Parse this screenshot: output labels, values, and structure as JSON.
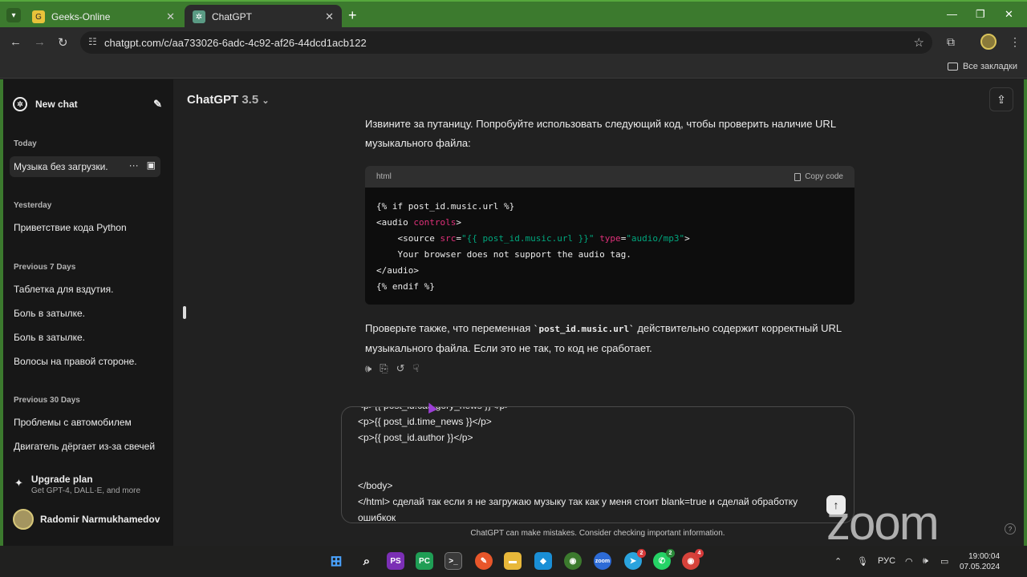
{
  "browser": {
    "tabs": [
      {
        "title": "Geeks-Online",
        "active": false
      },
      {
        "title": "ChatGPT",
        "active": true
      }
    ],
    "new_tab": "+",
    "url": "chatgpt.com/c/aa733026-6adc-4c92-af26-44dcd1acb122",
    "bookmarks_label": "Все закладки"
  },
  "sidebar": {
    "new_chat": "New chat",
    "sections": [
      {
        "title": "Today",
        "items": [
          "Музыка без загрузки."
        ]
      },
      {
        "title": "Yesterday",
        "items": [
          "Приветствие кода Python"
        ]
      },
      {
        "title": "Previous 7 Days",
        "items": [
          "Таблетка для вздутия.",
          "Боль в затылке.",
          "Боль в затылке.",
          "Волосы на правой стороне."
        ]
      },
      {
        "title": "Previous 30 Days",
        "items": [
          "Проблемы с автомобилем",
          "Двигатель дёргает из-за свечей"
        ]
      }
    ],
    "upgrade_title": "Upgrade plan",
    "upgrade_sub": "Get GPT-4, DALL·E, and more",
    "user_name": "Radomir Narmukhamedov"
  },
  "header": {
    "model": "ChatGPT",
    "version": "3.5"
  },
  "message": {
    "intro": "Извините за путаницу. Попробуйте использовать следующий код, чтобы проверить наличие URL музыкального файла:",
    "code_lang": "html",
    "copy_label": "Copy code",
    "outro_before": "Проверьте также, что переменная ",
    "outro_code": "`post_id.music.url`",
    "outro_after": " действительно содержит корректный URL музыкального файла. Если это не так, то код не сработает."
  },
  "composer": {
    "text": "<p>{{ post_id.category_news }}</p>\n<p>{{ post_id.time_news }}</p>\n<p>{{ post_id.author }}</p>\n\n\n</body>\n</html> сделай так если я не загружаю музыку так как у меня стоит blank=true и сделай обработку ошибкок"
  },
  "disclaimer": "ChatGPT can make mistakes. Consider checking important information.",
  "overlay": {
    "zoom": "zoom"
  },
  "taskbar": {
    "lang": "РУС",
    "time": "19:00:04",
    "date": "07.05.2024"
  },
  "colors": {
    "tabstrip": "#3c7a2e",
    "sidebar": "#171717",
    "page": "#212121",
    "code_attr": "#df3079",
    "code_string": "#00a67d"
  }
}
